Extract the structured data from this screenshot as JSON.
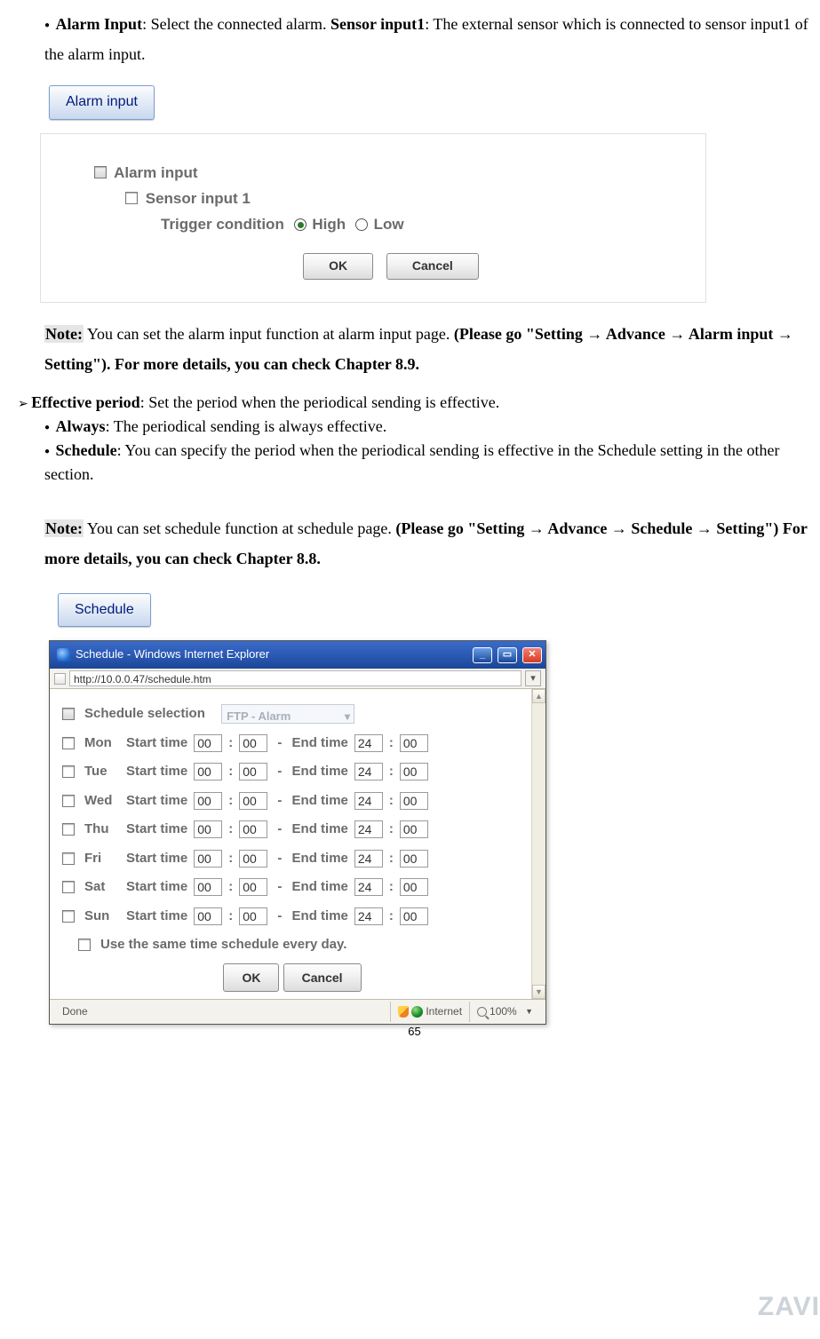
{
  "para1": {
    "b1": "Alarm Input",
    "t1": ": Select the connected alarm. ",
    "b2": "Sensor input1",
    "t2": ": The external sensor which is connected to sensor input1 of the alarm input."
  },
  "alarm_btn": "Alarm input",
  "alarm_panel": {
    "title": "Alarm input",
    "sensor": "Sensor input 1",
    "trigger_label": "Trigger condition",
    "high": "High",
    "low": "Low",
    "ok": "OK",
    "cancel": "Cancel"
  },
  "note1": {
    "label": "Note:",
    "t1": " You can set the alarm input function at alarm input page. ",
    "b1": "(Please go \"Setting → Advance → Alarm input → Setting\"). For more details, you can check Chapter 8.9."
  },
  "eff": {
    "b1": "Effective period",
    "t1": ": Set the period when the periodical sending is effective.",
    "always_b": "Always",
    "always_t": ": The periodical sending is always effective.",
    "sched_b": "Schedule",
    "sched_t": ": You can specify the period when the periodical sending is effective in the Schedule setting in the other section."
  },
  "note2": {
    "label": "Note:",
    "t1": " You can set schedule function at schedule page. ",
    "b1": "(Please go \"Setting → Advance → Schedule → Setting\") For more details, you can check Chapter 8.8."
  },
  "sched_btn": "Schedule",
  "ie": {
    "title": "Schedule - Windows Internet Explorer",
    "url": "http://10.0.0.47/schedule.htm",
    "sel_label": "Schedule selection",
    "sel_value": "FTP - Alarm",
    "start": "Start time",
    "end": "End time",
    "days": [
      {
        "d": "Mon",
        "sh": "00",
        "sm": "00",
        "eh": "24",
        "em": "00"
      },
      {
        "d": "Tue",
        "sh": "00",
        "sm": "00",
        "eh": "24",
        "em": "00"
      },
      {
        "d": "Wed",
        "sh": "00",
        "sm": "00",
        "eh": "24",
        "em": "00"
      },
      {
        "d": "Thu",
        "sh": "00",
        "sm": "00",
        "eh": "24",
        "em": "00"
      },
      {
        "d": "Fri",
        "sh": "00",
        "sm": "00",
        "eh": "24",
        "em": "00"
      },
      {
        "d": "Sat",
        "sh": "00",
        "sm": "00",
        "eh": "24",
        "em": "00"
      },
      {
        "d": "Sun",
        "sh": "00",
        "sm": "00",
        "eh": "24",
        "em": "00"
      }
    ],
    "same": "Use the same time schedule every day.",
    "ok": "OK",
    "cancel": "Cancel",
    "status_done": "Done",
    "status_zone": "Internet",
    "status_zoom": "100%"
  },
  "pagenum": "65",
  "watermark": "ZAVI"
}
